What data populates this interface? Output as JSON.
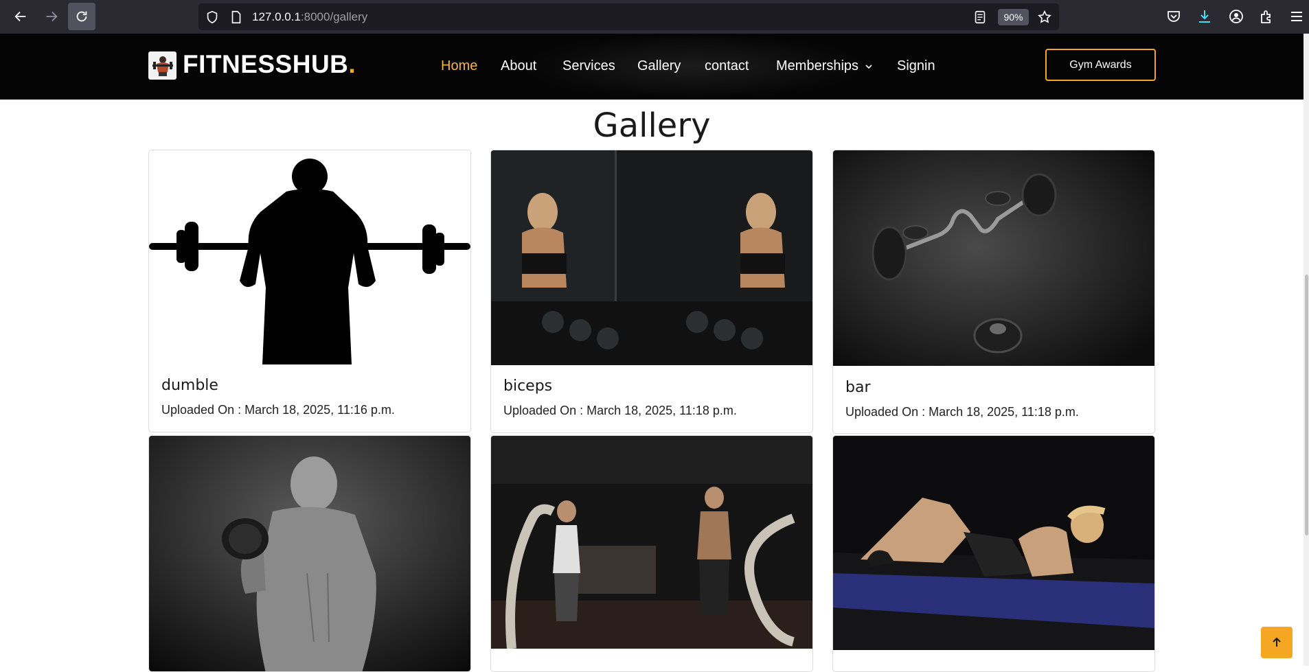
{
  "browser": {
    "url_host": "127.0.0.1",
    "url_path": ":8000/gallery",
    "zoom": "90%"
  },
  "site": {
    "logo_text": "FITNESSHUB",
    "logo_dot": ".",
    "nav": [
      {
        "label": "Home",
        "active": true
      },
      {
        "label": "About"
      },
      {
        "label": "Services"
      },
      {
        "label": "Gallery"
      },
      {
        "label": "contact"
      },
      {
        "label": "Memberships"
      },
      {
        "label": "Signin"
      }
    ],
    "cta_label": "Gym Awards",
    "accent_color": "#f5a623"
  },
  "gallery": {
    "title": "Gallery",
    "items": [
      {
        "title": "dumble",
        "meta": "Uploaded On : March 18, 2025, 11:16 p.m."
      },
      {
        "title": "biceps",
        "meta": "Uploaded On : March 18, 2025, 11:18 p.m."
      },
      {
        "title": "bar",
        "meta": "Uploaded On : March 18, 2025, 11:18 p.m."
      },
      {
        "title": "",
        "meta": ""
      },
      {
        "title": "",
        "meta": ""
      },
      {
        "title": "",
        "meta": ""
      }
    ]
  },
  "icons": {
    "back": "arrow-left-icon",
    "forward": "arrow-right-icon",
    "reload": "reload-icon",
    "back_to_top": "arrow-up-icon"
  }
}
